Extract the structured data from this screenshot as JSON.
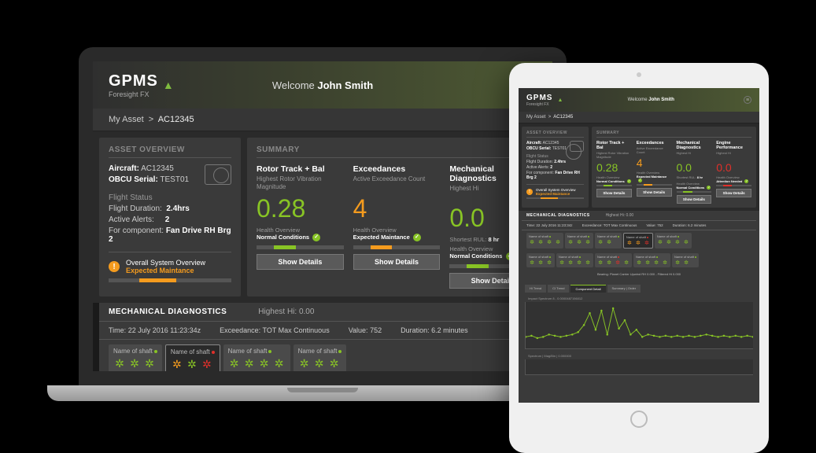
{
  "brand": {
    "name": "GPMS",
    "sub": "Foresight FX"
  },
  "welcome": {
    "prefix": "Welcome ",
    "user": "John Smith"
  },
  "breadcrumb": {
    "root": "My Asset",
    "sep": ">",
    "asset": "AC12345"
  },
  "overview": {
    "title": "ASSET OVERVIEW",
    "aircraft_lbl": "Aircraft:",
    "aircraft": "AC12345",
    "serial_lbl": "OBCU Serial:",
    "serial": "TEST01",
    "status_h": "Flight Status",
    "dur_lbl": "Flight Duration:",
    "dur": "2.4hrs",
    "alerts_lbl": "Active Alerts:",
    "alerts": "2",
    "comp_lbl": "For component:",
    "comp": "Fan Drive RH Brg 2",
    "sys_h": "Overall System Overview",
    "sys_s": "Expected Maintance"
  },
  "summary": {
    "title": "SUMMARY",
    "cards": [
      {
        "title": "Rotor Track + Bal",
        "sub": "Highest Rotor Vibration Magnitude",
        "value": "0.28",
        "color": "green",
        "foot_h": "Health Overview",
        "foot_s": "Normal Conditions",
        "btn": "Show Details"
      },
      {
        "title": "Exceedances",
        "sub": "Active Exceedance Count",
        "value": "4",
        "color": "orange",
        "foot_h": "Health Overview",
        "foot_s": "Expected Maintance",
        "btn": "Show Details"
      },
      {
        "title": "Mechanical Diagnostics",
        "sub": "Highest Hi",
        "value": "0.0",
        "color": "green",
        "extra_lbl": "Shortest RUL:",
        "extra_val": "8 hr",
        "foot_h": "Health Overview",
        "foot_s": "Normal Conditions",
        "btn": "Show Details"
      },
      {
        "title": "Engine Performance",
        "sub": "Highest Hi",
        "value": "0.0",
        "color": "red",
        "foot_h": "Health Overview",
        "foot_s": "Attention Needed",
        "btn": "Show Details"
      }
    ]
  },
  "mech": {
    "title": "MECHANICAL DIAGNOSTICS",
    "hi_lbl": "Highest Hi:",
    "hi_val": "0.00",
    "time_lbl": "Time:",
    "time": "22 July 2016 11:23:34z",
    "ex_lbl": "Exceedance:",
    "ex": "TOT Max Continuous",
    "val_lbl": "Value:",
    "val": "752",
    "dur_lbl": "Duration:",
    "dur": "6.2 minutes",
    "shaft_lbl": "Name of shaft",
    "gear_colors": [
      [
        "g",
        "g",
        "g"
      ],
      [
        "o",
        "g",
        "r"
      ],
      [
        "g",
        "g",
        "g",
        "g"
      ],
      [
        "g",
        "g",
        "g"
      ]
    ]
  },
  "tablet_mech": {
    "shafts_row1": [
      [
        "g",
        "g",
        "g",
        "g"
      ],
      [
        "g",
        "g",
        "g"
      ],
      [
        "g",
        "g"
      ],
      [
        "o",
        "o",
        "r"
      ],
      [
        "g",
        "g",
        "g",
        "g"
      ]
    ],
    "shafts_row2": [
      [
        "g",
        "g",
        "g"
      ],
      [
        "g",
        "g",
        "g",
        "g"
      ],
      [
        "g",
        "g",
        "r",
        "g"
      ],
      [
        "g",
        "g",
        "g",
        "g"
      ],
      [
        "g",
        "g"
      ]
    ]
  },
  "bearing": "Bearing: Planet Carrier Upwind RH 0.000 - Filtered Hi 0.000",
  "tabs": [
    "Hi Trend",
    "CI Trend",
    "Component Detail",
    "Summary | Order"
  ],
  "chart_titles": {
    "top": "Impact Spectrum 8 - 0.0000487156012",
    "bottom": "Spectrum | Mag/Bin | 0.000000"
  },
  "chart_data": {
    "type": "line",
    "x": [
      0,
      1,
      2,
      3,
      4,
      5,
      6,
      7,
      8,
      9,
      10,
      11,
      12,
      13,
      14,
      15,
      16,
      17,
      18,
      19,
      20,
      21,
      22,
      23,
      24,
      25,
      26,
      27,
      28,
      29,
      30,
      31,
      32,
      33,
      34,
      35,
      36,
      37,
      38,
      39
    ],
    "values": [
      8,
      9,
      7,
      8,
      10,
      9,
      8,
      9,
      10,
      12,
      18,
      28,
      14,
      30,
      10,
      32,
      15,
      22,
      10,
      14,
      8,
      10,
      9,
      8,
      9,
      8,
      9,
      8,
      9,
      8,
      9,
      10,
      9,
      8,
      9,
      8,
      9,
      8,
      9,
      8
    ],
    "ylim": [
      0,
      35
    ]
  },
  "colors": {
    "g": "#88c425",
    "o": "#f49b1e",
    "r": "#e0302a"
  }
}
